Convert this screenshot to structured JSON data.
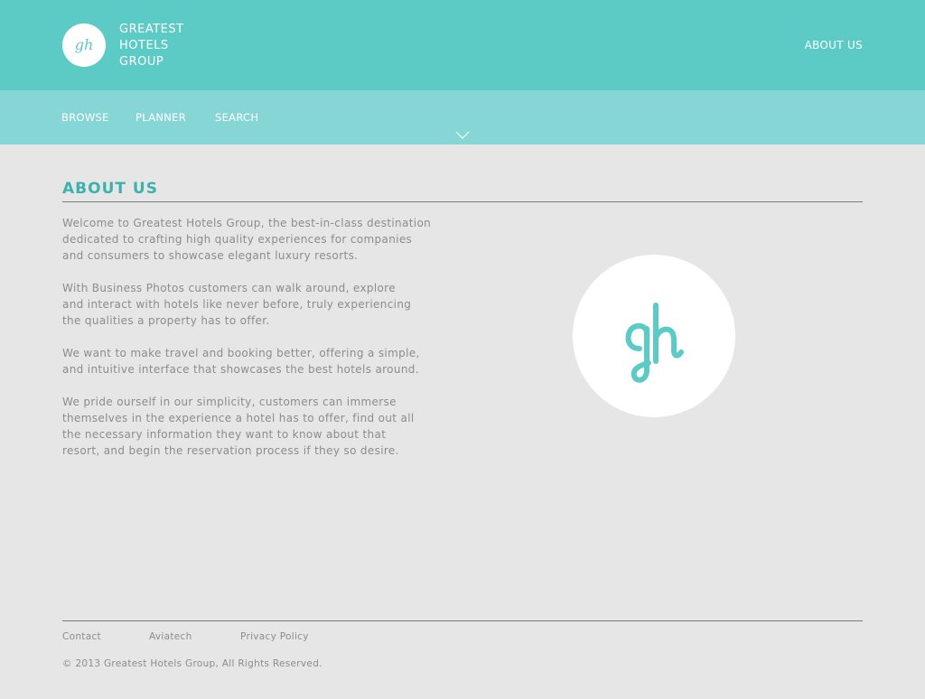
{
  "brand": {
    "logo_text": "gh",
    "name_lines": [
      "GREATEST",
      "HOTELS",
      "GROUP"
    ]
  },
  "header": {
    "about_link": "ABOUT US"
  },
  "nav": {
    "items": [
      "BROWSE",
      "PLANNER",
      "SEARCH"
    ]
  },
  "main": {
    "title": "ABOUT US",
    "paragraphs": [
      "Welcome to Greatest Hotels Group, the best-in-class destination\ndedicated to crafting high quality experiences for companies\nand consumers to showcase elegant luxury resorts.",
      "With Business Photos customers can walk around, explore\nand interact with hotels like never before, truly experiencing\nthe qualities a property has to offer.",
      "We want to make travel and booking better, offering a simple,\nand intuitive interface that showcases the best hotels around.",
      "We pride ourself in our simplicity, customers can immerse\nthemselves in the experience a hotel has to offer, find out all\nthe necessary information they want to know about that\nresort, and begin the reservation process if they so desire."
    ]
  },
  "footer": {
    "links": [
      "Contact",
      "Aviatech",
      "Privacy Policy"
    ],
    "copyright": "© 2013 Greatest Hotels Group, All Rights Reserved."
  },
  "colors": {
    "header_bg": "#5ccac5",
    "nav_bg": "#87d6d6",
    "accent": "#3fb1ad",
    "page_bg": "#e6e6e6",
    "body_text": "#8c8c8c"
  },
  "icons": {
    "logo": "gh-monogram-icon",
    "nav_indicator": "chevron-down-icon"
  }
}
